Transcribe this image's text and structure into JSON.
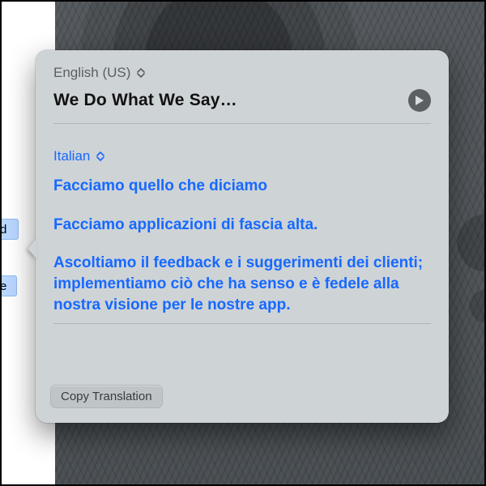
{
  "source": {
    "language_label": "English (US)",
    "title": "We Do What We Say…"
  },
  "target": {
    "language_label": "Italian",
    "paragraphs": [
      "Facciamo quello che diciamo",
      "Facciamo applicazioni di fascia alta.",
      "Ascoltiamo il feedback e i suggerimenti dei clienti; implementiamo ciò che ha senso e è fedele alla nostra visione per le nostre app."
    ]
  },
  "actions": {
    "copy_label": "Copy Translation"
  },
  "selection_fragments": {
    "left_top": "d",
    "left_bottom": "e"
  },
  "colors": {
    "link_blue": "#1769ff",
    "popover_bg": "#ced3d6"
  }
}
